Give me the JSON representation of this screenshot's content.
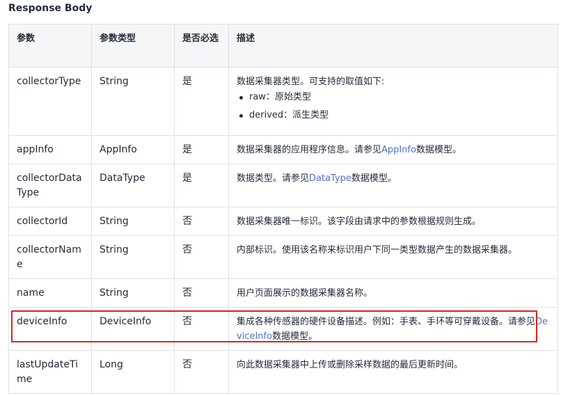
{
  "title": "Response Body",
  "columns": [
    "参数",
    "参数类型",
    "是否必选",
    "描述"
  ],
  "rows": [
    {
      "param": "collectorType",
      "type": "String",
      "required": "是",
      "desc": "数据采集器类型。可支持的取值如下:",
      "list": [
        "raw：原始类型",
        "derived：派生类型"
      ]
    },
    {
      "param": "appInfo",
      "type": "AppInfo",
      "required": "是",
      "desc_pre": "数据采集器的应用程序信息。请参见",
      "link": "AppInfo",
      "desc_post": "数据模型。"
    },
    {
      "param": "collectorDataType",
      "type": "DataType",
      "required": "是",
      "desc_pre": "数据类型。请参见",
      "link": "DataType",
      "desc_post": "数据模型。"
    },
    {
      "param": "collectorId",
      "type": "String",
      "required": "否",
      "desc": "数据采集器唯一标识。该字段由请求中的参数根据规则生成。"
    },
    {
      "param": "collectorName",
      "type": "String",
      "required": "否",
      "desc": "内部标识。使用该名称来标识用户下同一类型数据产生的数据采集器。"
    },
    {
      "param": "name",
      "type": "String",
      "required": "否",
      "desc": "用户页面展示的数据采集器名称。"
    },
    {
      "param": "deviceInfo",
      "type": "DeviceInfo",
      "required": "否",
      "desc_pre": "集成各种传感器的硬件设备描述。例如：手表、手环等可穿戴设备。请参见",
      "link": "DeviceInfo",
      "desc_post": "数据模型。"
    },
    {
      "param": "lastUpdateTime",
      "type": "Long",
      "required": "否",
      "desc": "向此数据采集器中上传或删除采样数据的最后更新时间。"
    }
  ]
}
